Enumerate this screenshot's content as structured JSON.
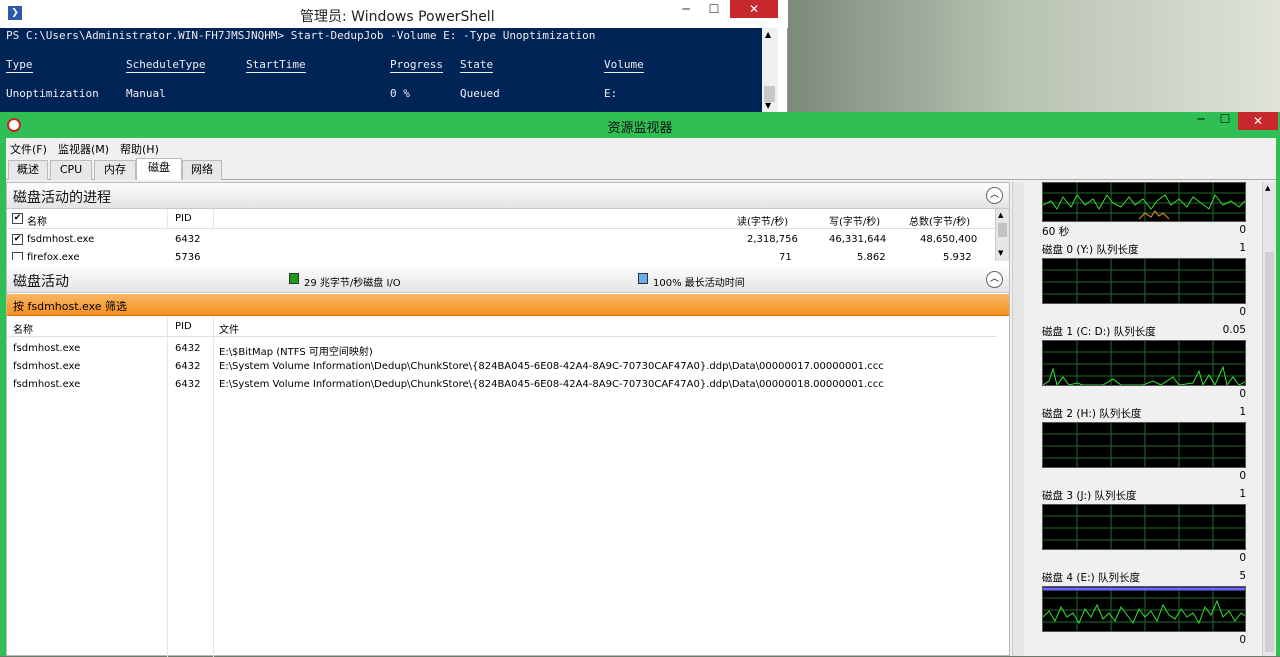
{
  "powershell": {
    "title": "管理员: Windows PowerShell",
    "prompt": "PS C:\\Users\\Administrator.WIN-FH7JMSJNQHM> Start-DedupJob -Volume E: -Type Unoptimization",
    "columns": [
      "Type",
      "ScheduleType",
      "StartTime",
      "Progress",
      "State",
      "Volume"
    ],
    "row": [
      "Unoptimization",
      "Manual",
      "",
      "0 %",
      "Queued",
      "E:"
    ]
  },
  "resmon": {
    "title": "资源监视器",
    "menu": [
      "文件(F)",
      "监视器(M)",
      "帮助(H)"
    ],
    "tabs": [
      "概述",
      "CPU",
      "内存",
      "磁盘",
      "网络"
    ],
    "active_tab": "磁盘",
    "processes_section": {
      "title": "磁盘活动的进程",
      "headers": [
        "名称",
        "PID",
        "读(字节/秒)",
        "写(字节/秒)",
        "总数(字节/秒)"
      ],
      "rows": [
        {
          "checked": true,
          "name": "fsdmhost.exe",
          "pid": "6432",
          "read": "2,318,756",
          "write": "46,331,644",
          "total": "48,650,400"
        },
        {
          "checked": false,
          "name": "firefox.exe",
          "pid": "5736",
          "read": "71",
          "write": "5,862",
          "total": "5,932"
        }
      ]
    },
    "activity_section": {
      "title": "磁盘活动",
      "legend_io": "29 兆字节/秒磁盘 I/O",
      "legend_time": "100% 最长活动时间",
      "io_color": "#1a9e1a",
      "time_color": "#6aaef0",
      "filter": "按 fsdmhost.exe 筛选",
      "headers": [
        "名称",
        "PID",
        "文件"
      ],
      "rows": [
        {
          "name": "fsdmhost.exe",
          "pid": "6432",
          "file": "E:\\$BitMap (NTFS 可用空间映射)"
        },
        {
          "name": "fsdmhost.exe",
          "pid": "6432",
          "file": "E:\\System Volume Information\\Dedup\\ChunkStore\\{824BA045-6E08-42A4-8A9C-70730CAF47A0}.ddp\\Data\\00000017.00000001.ccc"
        },
        {
          "name": "fsdmhost.exe",
          "pid": "6432",
          "file": "E:\\System Volume Information\\Dedup\\ChunkStore\\{824BA045-6E08-42A4-8A9C-70730CAF47A0}.ddp\\Data\\00000018.00000001.ccc"
        }
      ]
    },
    "graphs": {
      "top": {
        "label": "60 秒",
        "value": "0"
      },
      "items": [
        {
          "label": "磁盘 0 (Y:) 队列长度",
          "max": "1",
          "min": "0"
        },
        {
          "label": "磁盘 1 (C: D:) 队列长度",
          "max": "0.05",
          "min": "0"
        },
        {
          "label": "磁盘 2 (H:) 队列长度",
          "max": "1",
          "min": "0"
        },
        {
          "label": "磁盘 3 (J:) 队列长度",
          "max": "1",
          "min": "0"
        },
        {
          "label": "磁盘 4 (E:) 队列长度",
          "max": "5",
          "min": "0"
        }
      ]
    }
  }
}
